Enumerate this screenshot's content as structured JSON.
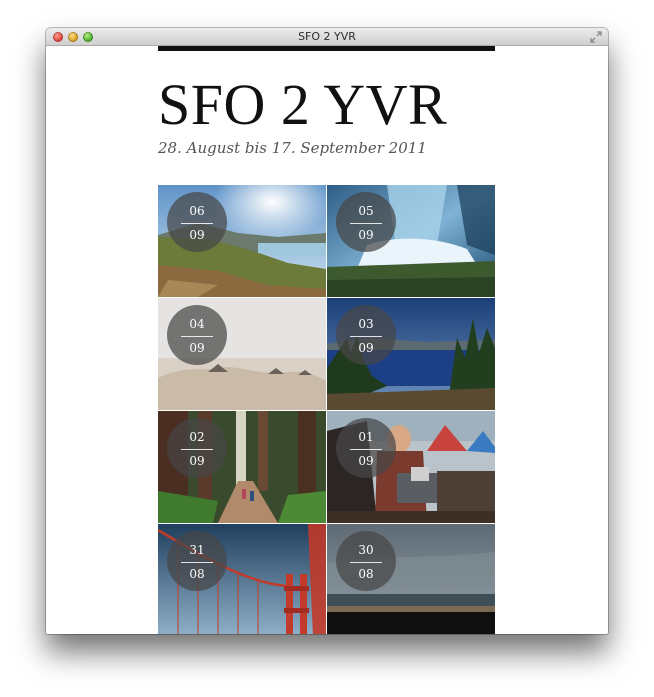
{
  "window": {
    "title": "SFO 2 YVR"
  },
  "page": {
    "title": "SFO 2 YVR",
    "subtitle": "28. August bis 17. September 2011"
  },
  "tiles": [
    {
      "day": "06",
      "month": "09",
      "photo": "mountain-meadow-lake"
    },
    {
      "day": "05",
      "month": "09",
      "photo": "waterfall-mist"
    },
    {
      "day": "04",
      "month": "09",
      "photo": "foggy-sand-dunes"
    },
    {
      "day": "03",
      "month": "09",
      "photo": "crater-lake-forest"
    },
    {
      "day": "02",
      "month": "09",
      "photo": "redwood-forest-trail"
    },
    {
      "day": "01",
      "month": "09",
      "photo": "campsite-cooking"
    },
    {
      "day": "31",
      "month": "08",
      "photo": "golden-gate-bridge"
    },
    {
      "day": "30",
      "month": "08",
      "photo": "foggy-bay-view"
    }
  ],
  "colors": {
    "badge": "#464646",
    "topbar": "#111111"
  }
}
